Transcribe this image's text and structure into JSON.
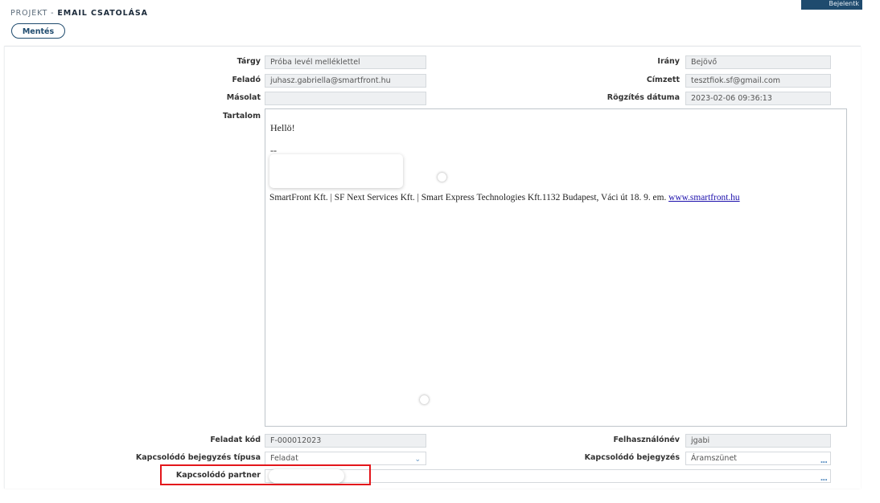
{
  "header": {
    "breadcrumb": "PROJEKT - ",
    "title": "EMAIL CSATOLÁSA"
  },
  "top_button": {
    "label": "Bejelentk"
  },
  "toolbar": {
    "save_label": "Mentés"
  },
  "form": {
    "subject": {
      "label": "Tárgy",
      "value": "Próba levél melléklettel"
    },
    "direction": {
      "label": "Irány",
      "value": "Bejövő"
    },
    "sender": {
      "label": "Feladó",
      "value": "juhasz.gabriella@smartfront.hu"
    },
    "recipient": {
      "label": "Címzett",
      "value": "tesztfiok.sf@gmail.com"
    },
    "copy": {
      "label": "Másolat",
      "value": ""
    },
    "recorded": {
      "label": "Rögzítés dátuma",
      "value": "2023-02-06 09:36:13"
    },
    "content": {
      "label": "Tartalom",
      "greeting": "Hellö!",
      "separator": "--",
      "signature": "SmartFront Kft. | SF Next Services Kft. | Smart Express Technologies Kft.1132 Budapest, Váci út 18. 9. em. ",
      "link": "www.smartfront.hu"
    },
    "task_code": {
      "label": "Feladat kód",
      "value": "F-000012023"
    },
    "username": {
      "label": "Felhasználónév",
      "value": "jgabi"
    },
    "related_type": {
      "label": "Kapcsolódó bejegyzés típusa",
      "value": "Feladat"
    },
    "related_entry": {
      "label": "Kapcsolódó bejegyzés",
      "value": "Áramszünet"
    },
    "related_partner": {
      "label": "Kapcsolódó partner",
      "value": ""
    }
  },
  "icons": {
    "select": "chevron-down-icon",
    "lookup": "ellipsis-icon"
  },
  "colors": {
    "accent": "#1f4b6e",
    "highlight": "#e3161b",
    "link": "#1a0dab"
  }
}
